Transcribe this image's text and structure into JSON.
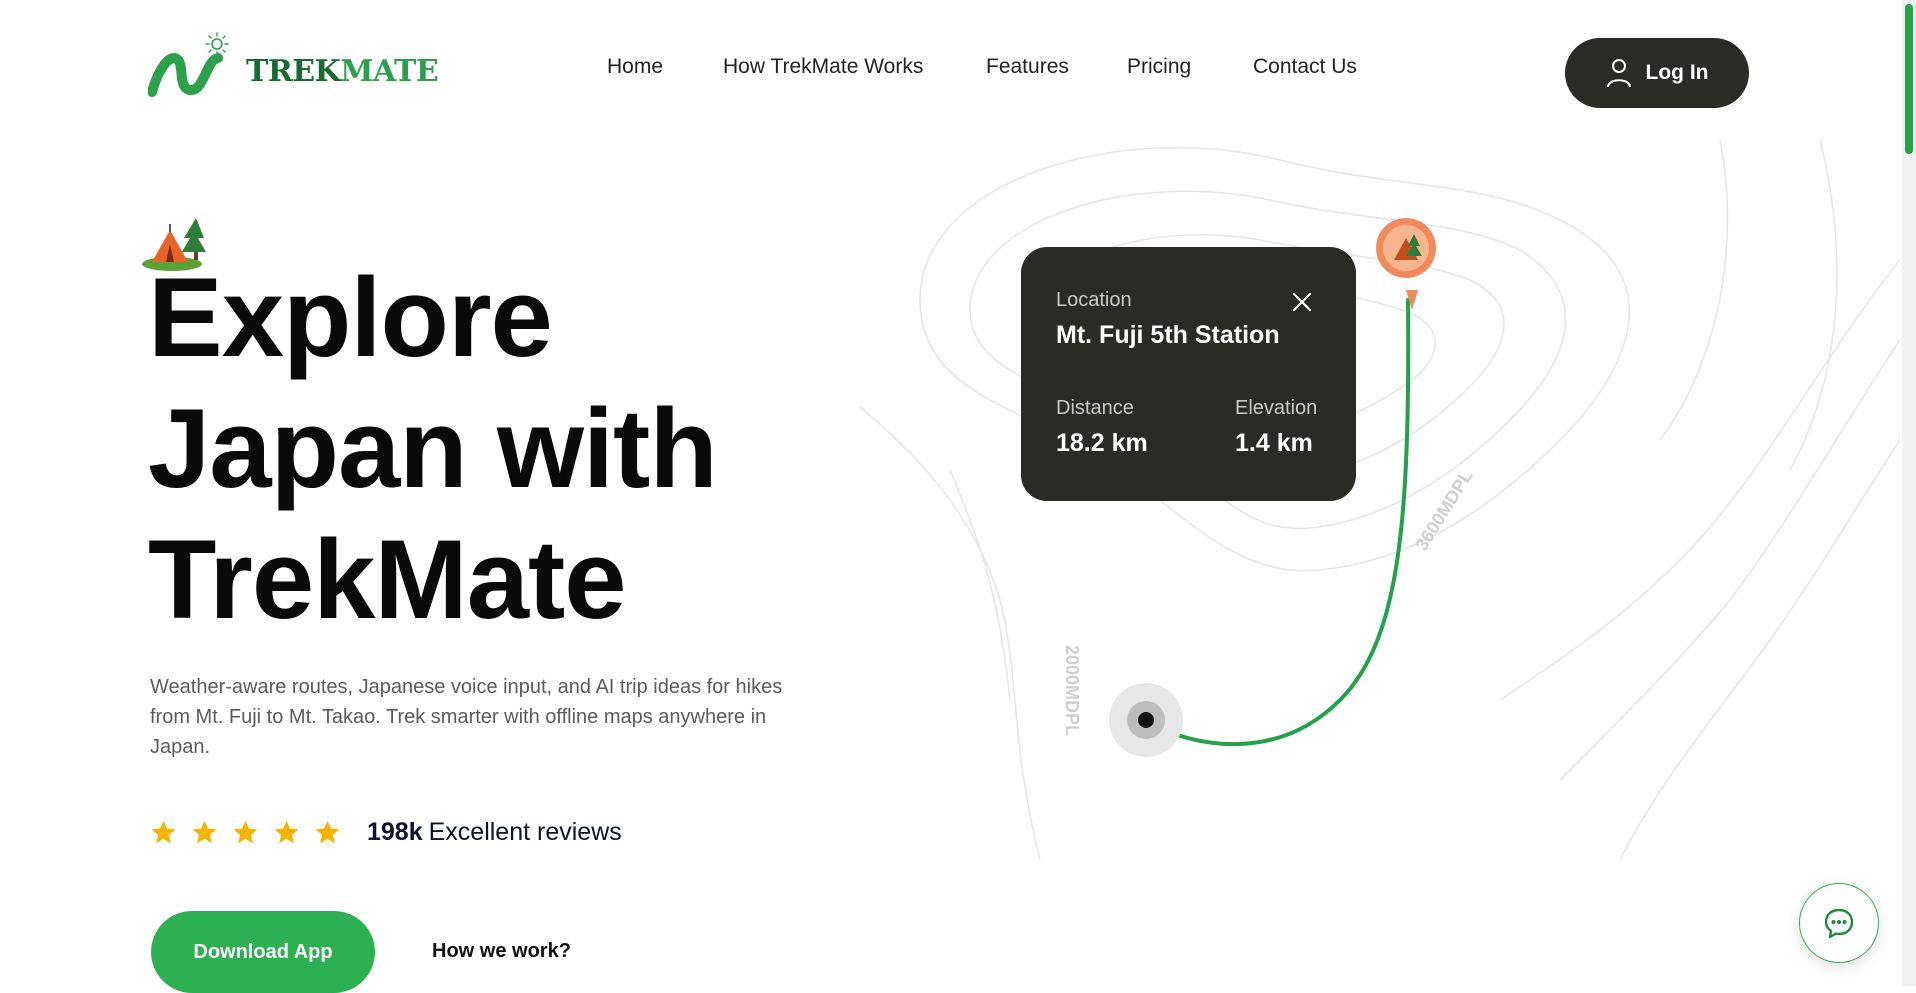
{
  "brand": {
    "name_part1": "TREK",
    "name_part2": "MATE",
    "accent": "#2db052",
    "dark": "#2a2b27"
  },
  "nav": {
    "items": [
      {
        "label": "Home"
      },
      {
        "label": "How TrekMate Works"
      },
      {
        "label": "Features"
      },
      {
        "label": "Pricing"
      },
      {
        "label": "Contact Us"
      }
    ],
    "login_label": "Log In",
    "login_icon": "user-icon"
  },
  "hero": {
    "emoji": "tent-icon",
    "title_lines": [
      "Explore",
      "Japan with",
      "TrekMate"
    ],
    "description": "Weather-aware routes, Japanese voice input, and AI trip ideas for hikes from Mt. Fuji to Mt. Takao. Trek smarter with offline maps anywhere in Japan.",
    "rating": {
      "stars": 5,
      "count": "198k",
      "label": "Excellent reviews"
    },
    "cta_primary": "Download App",
    "cta_secondary": "How we work?"
  },
  "map": {
    "contour_labels": [
      "3600MDPL",
      "2000MDPL"
    ],
    "info_card": {
      "location_label": "Location",
      "location_value": "Mt. Fuji 5th Station",
      "distance_label": "Distance",
      "distance_value": "18.2 km",
      "elevation_label": "Elevation",
      "elevation_value": "1.4 km"
    },
    "route_color": "#22a34a",
    "destination_pin_color": "#f08a5d"
  },
  "chat": {
    "icon": "chat-icon"
  }
}
